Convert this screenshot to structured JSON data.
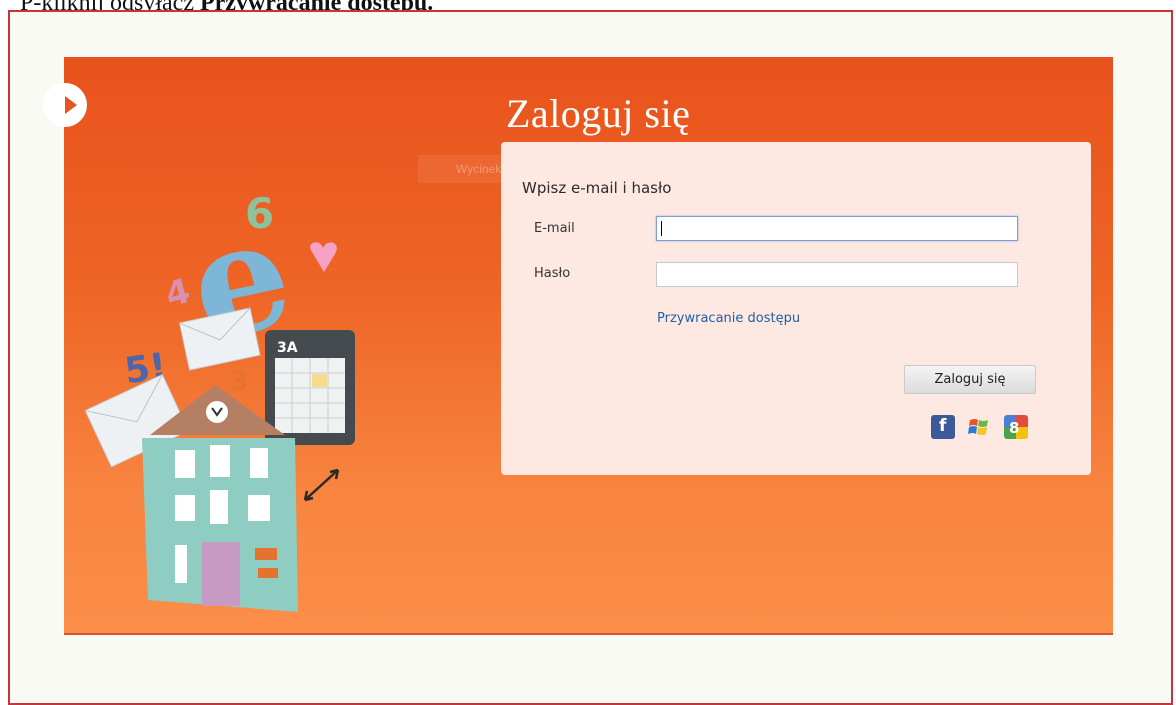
{
  "caption": {
    "prefix": "P-kliknij odsyłacz ",
    "bold": "Przywracanie dostępu."
  },
  "header": {
    "title": "Zaloguj się"
  },
  "ghost_tooltip": "Wycinek prostokątny",
  "form": {
    "heading": "Wpisz e-mail i hasło",
    "email_label": "E-mail",
    "email_value": "",
    "password_label": "Hasło",
    "password_value": "",
    "restore_link": "Przywracanie dostępu",
    "submit_label": "Zaloguj się"
  },
  "social": [
    {
      "name": "facebook-icon",
      "color": "#3b5a9a"
    },
    {
      "name": "windows-live-icon",
      "color": "#2d7bd4"
    },
    {
      "name": "google-icon",
      "color": "#4aa34a"
    }
  ],
  "illustration": {
    "calendar_label": "3A",
    "number_six": "6",
    "number_four": "4",
    "number_five": "5!",
    "number_three": "3"
  },
  "colors": {
    "banner": "#e8521c",
    "panel": "#fde9e2",
    "link": "#1f5fa8",
    "frame": "#c8323a"
  }
}
